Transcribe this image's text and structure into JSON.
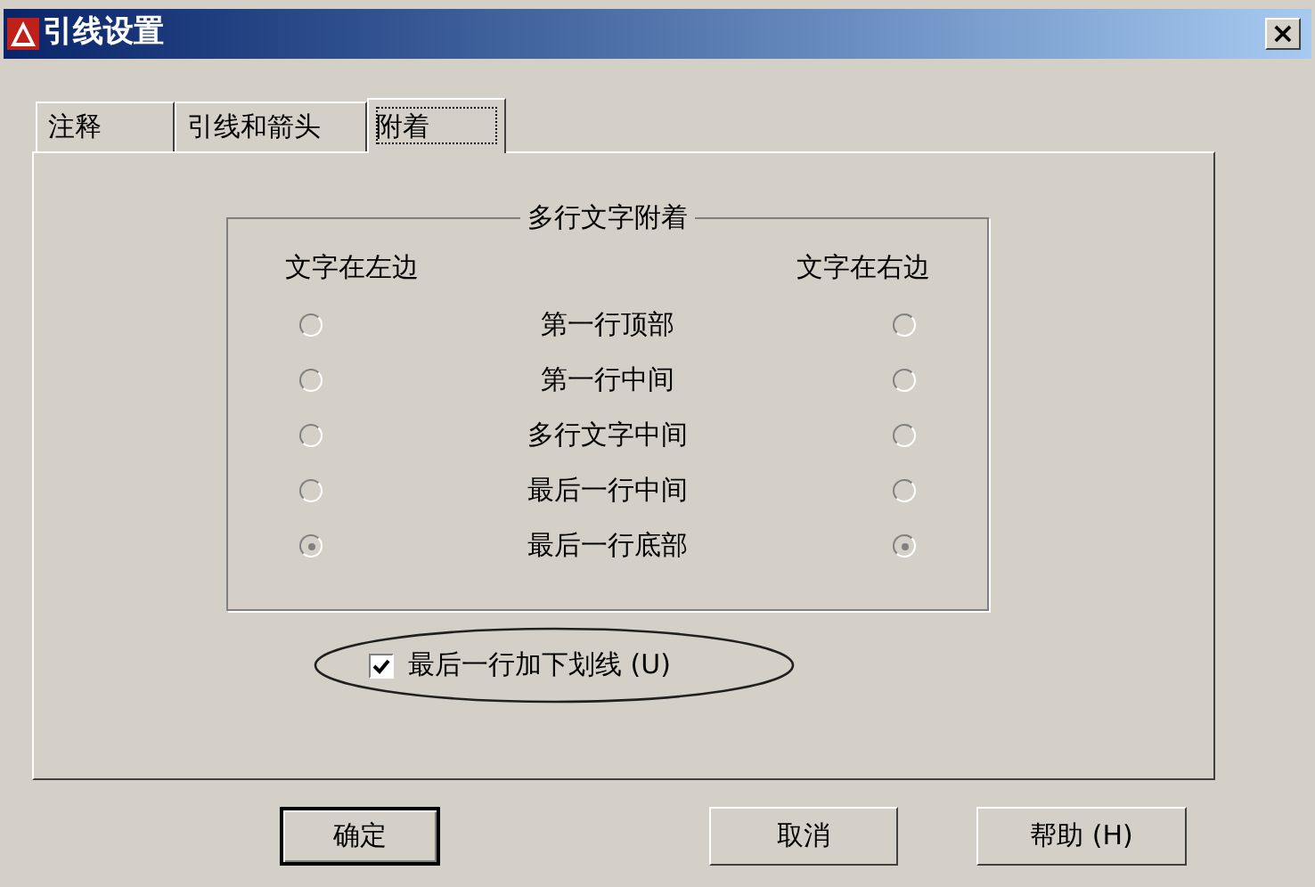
{
  "window": {
    "title": "引线设置",
    "close": "×"
  },
  "tabs": [
    {
      "label": "注释",
      "selected": false
    },
    {
      "label": "引线和箭头",
      "selected": false
    },
    {
      "label": "附着",
      "selected": true
    }
  ],
  "group": {
    "title": "多行文字附着",
    "left_heading": "文字在左边",
    "right_heading": "文字在右边",
    "rows": [
      {
        "label": "第一行顶部",
        "left_selected": false,
        "right_selected": false
      },
      {
        "label": "第一行中间",
        "left_selected": false,
        "right_selected": false
      },
      {
        "label": "多行文字中间",
        "left_selected": false,
        "right_selected": false
      },
      {
        "label": "最后一行中间",
        "left_selected": false,
        "right_selected": false
      },
      {
        "label": "最后一行底部",
        "left_selected": true,
        "right_selected": true
      }
    ]
  },
  "underline_checkbox": {
    "label": "最后一行加下划线 (U)",
    "checked": true
  },
  "buttons": [
    {
      "label": "确定",
      "default": true
    },
    {
      "label": "取消",
      "default": false
    },
    {
      "label": "帮助 (H)",
      "default": false
    }
  ]
}
